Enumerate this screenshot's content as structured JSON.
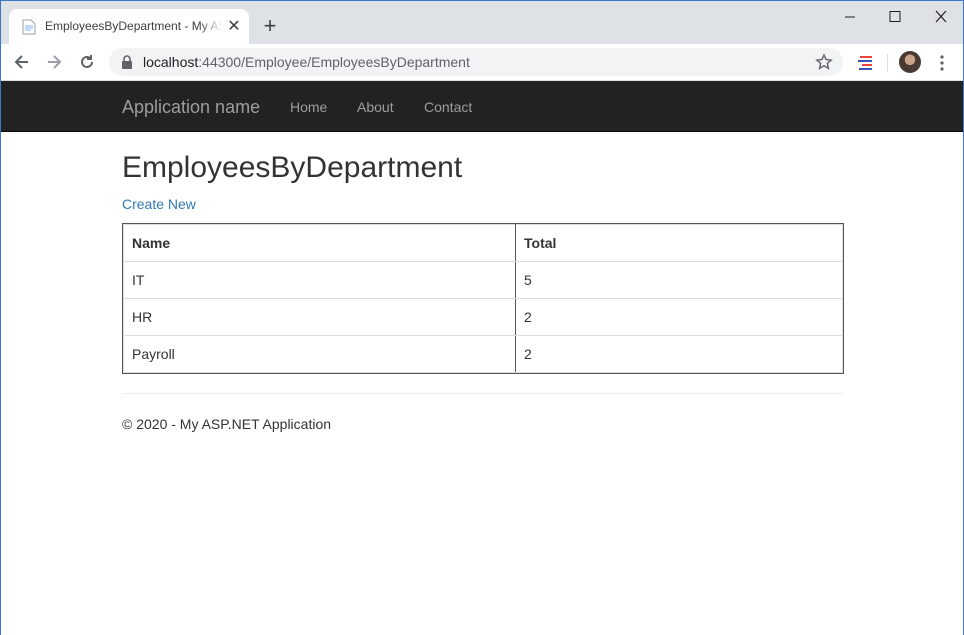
{
  "browser": {
    "tab_title": "EmployeesByDepartment - My ASP.NET Application",
    "url_host": "localhost",
    "url_path": ":44300/Employee/EmployeesByDepartment",
    "new_tab": "+",
    "icons": [
      "page-icon",
      "close-icon",
      "back-arrow-icon",
      "forward-arrow-icon",
      "reload-icon",
      "lock-icon",
      "star-icon",
      "extension-icon",
      "avatar",
      "menu-dots-icon",
      "minimize-icon",
      "maximize-icon",
      "window-close-icon"
    ]
  },
  "navbar": {
    "brand": "Application name",
    "links": [
      "Home",
      "About",
      "Contact"
    ]
  },
  "main": {
    "title": "EmployeesByDepartment",
    "create_link": "Create New",
    "table": {
      "headers": [
        "Name",
        "Total"
      ],
      "rows": [
        [
          "IT",
          "5"
        ],
        [
          "HR",
          "2"
        ],
        [
          "Payroll",
          "2"
        ]
      ]
    }
  },
  "footer": {
    "text": "© 2020 - My ASP.NET Application"
  }
}
